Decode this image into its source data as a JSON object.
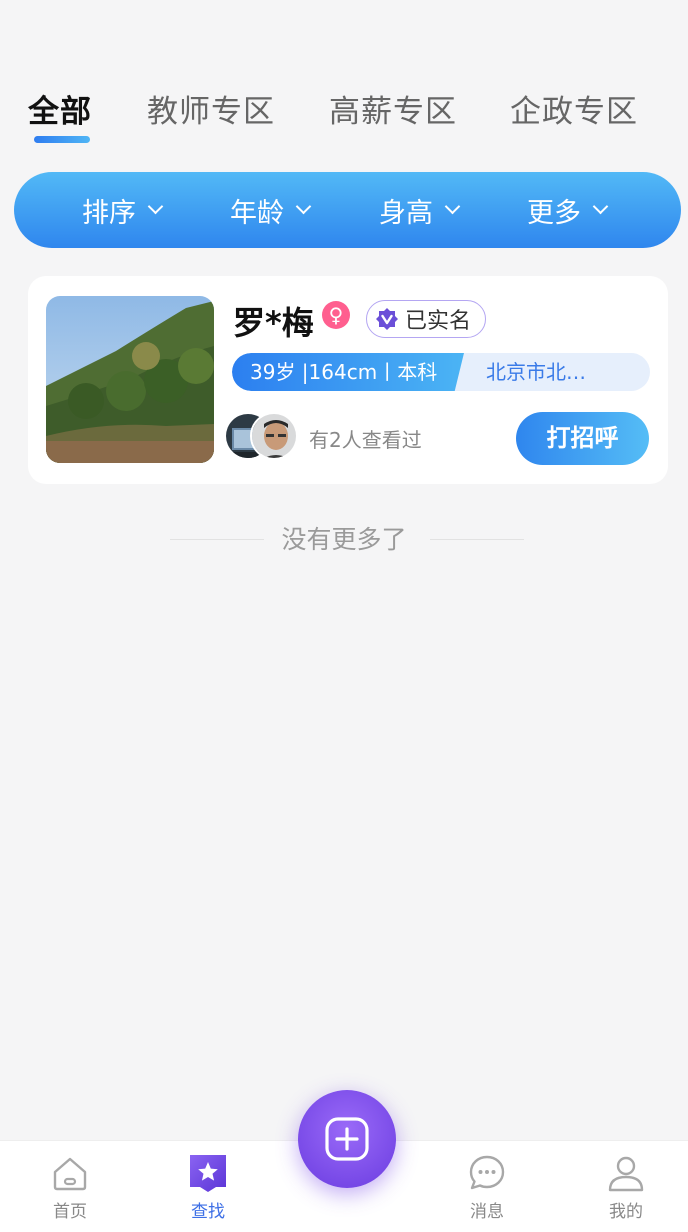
{
  "tabs": [
    {
      "label": "全部",
      "active": true
    },
    {
      "label": "教师专区",
      "active": false
    },
    {
      "label": "高薪专区",
      "active": false
    },
    {
      "label": "企政专区",
      "active": false
    }
  ],
  "filters": [
    {
      "label": "排序"
    },
    {
      "label": "年龄"
    },
    {
      "label": "身高"
    },
    {
      "label": "更多"
    }
  ],
  "profile": {
    "name": "罗*梅",
    "gender_symbol": "♀",
    "verified_label": "已实名",
    "tag_main": "39岁 |164cm丨本科",
    "tag_location": "北京市北…",
    "viewed_text": "有2人查看过",
    "greet_label": "打招呼"
  },
  "footer_text": "没有更多了",
  "bottom_nav": [
    {
      "label": "首页",
      "icon": "home-icon",
      "active": false
    },
    {
      "label": "查找",
      "icon": "star-icon",
      "active": true
    },
    {
      "label": "消息",
      "icon": "message-icon",
      "active": false
    },
    {
      "label": "我的",
      "icon": "user-icon",
      "active": false
    }
  ],
  "colors": {
    "accent_blue": "#2f86ee",
    "active_nav": "#3d6fe6",
    "fab_purple": "#7a4ae8",
    "gender_pink": "#ff5f8f"
  }
}
